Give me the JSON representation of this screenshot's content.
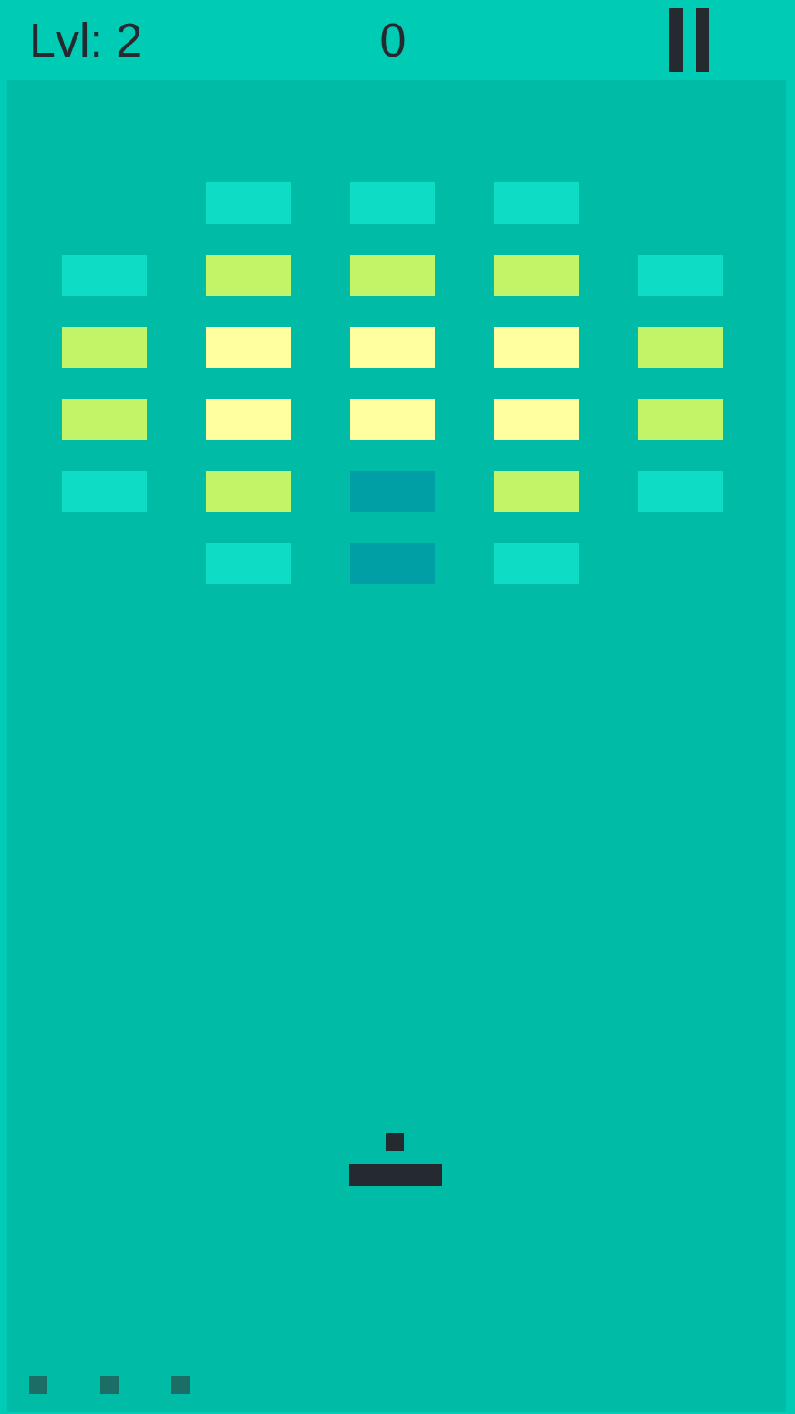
{
  "hud": {
    "level_label": "Lvl: 2",
    "score": "0",
    "paused": false
  },
  "bricks": [
    [
      {
        "kind": "empty"
      },
      {
        "kind": "brick",
        "color": "#0fdcc4"
      },
      {
        "kind": "brick",
        "color": "#0fdcc4"
      },
      {
        "kind": "brick",
        "color": "#0fdcc4"
      },
      {
        "kind": "empty"
      }
    ],
    [
      {
        "kind": "brick",
        "color": "#0fdcc4"
      },
      {
        "kind": "brick",
        "color": "#c1f567"
      },
      {
        "kind": "brick",
        "color": "#c1f567"
      },
      {
        "kind": "brick",
        "color": "#c1f567"
      },
      {
        "kind": "brick",
        "color": "#0fdcc4"
      }
    ],
    [
      {
        "kind": "brick",
        "color": "#c1f567"
      },
      {
        "kind": "brick",
        "color": "#ffffa0"
      },
      {
        "kind": "brick",
        "color": "#ffffa0"
      },
      {
        "kind": "brick",
        "color": "#ffffa0"
      },
      {
        "kind": "brick",
        "color": "#c1f567"
      }
    ],
    [
      {
        "kind": "brick",
        "color": "#c1f567"
      },
      {
        "kind": "brick",
        "color": "#ffffa0"
      },
      {
        "kind": "brick",
        "color": "#ffffa0"
      },
      {
        "kind": "brick",
        "color": "#ffffa0"
      },
      {
        "kind": "brick",
        "color": "#c1f567"
      }
    ],
    [
      {
        "kind": "brick",
        "color": "#0fdcc4"
      },
      {
        "kind": "brick",
        "color": "#c1f567"
      },
      {
        "kind": "brick",
        "color": "#009ea5"
      },
      {
        "kind": "brick",
        "color": "#c1f567"
      },
      {
        "kind": "brick",
        "color": "#0fdcc4"
      }
    ],
    [
      {
        "kind": "empty"
      },
      {
        "kind": "brick",
        "color": "#0fdcc4"
      },
      {
        "kind": "brick",
        "color": "#009ea5"
      },
      {
        "kind": "brick",
        "color": "#0fdcc4"
      },
      {
        "kind": "empty"
      }
    ]
  ],
  "lives_remaining": 3
}
